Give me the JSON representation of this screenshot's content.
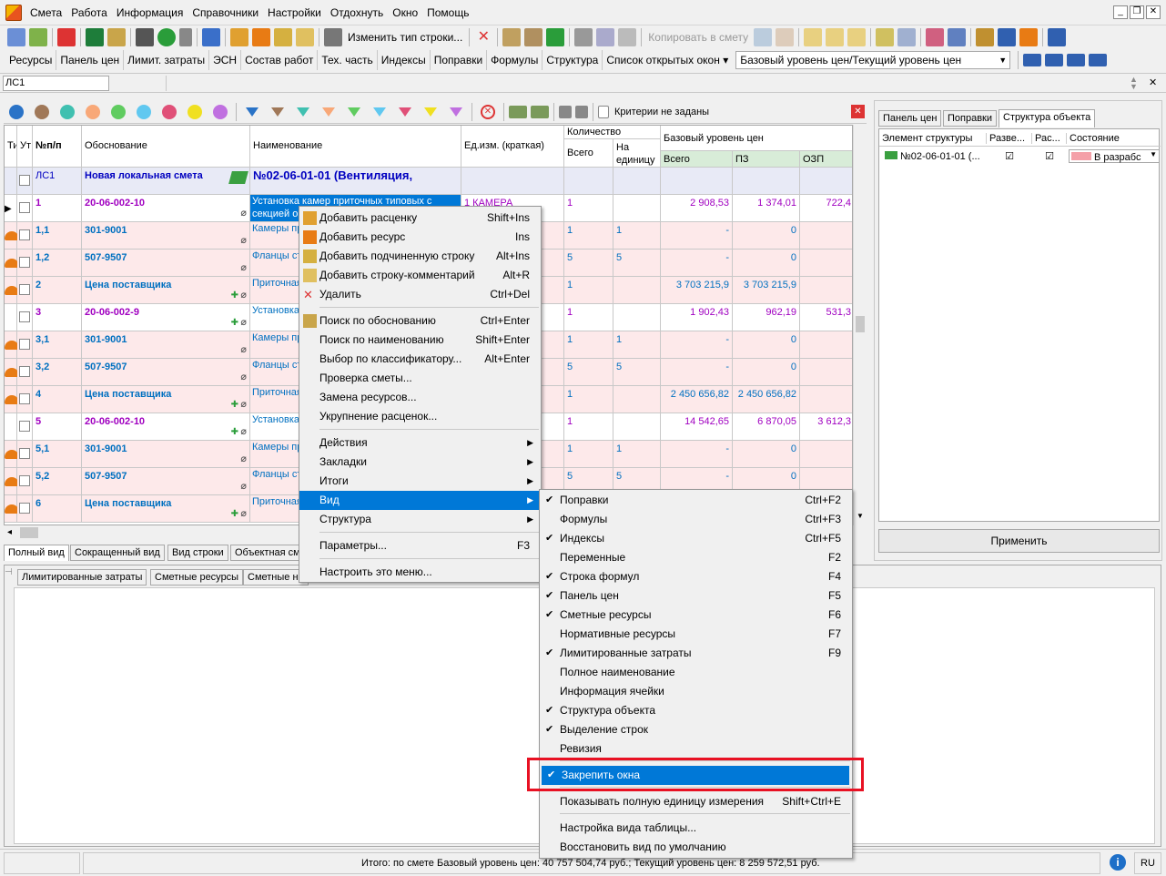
{
  "menubar": {
    "items": [
      "Смета",
      "Работа",
      "Информация",
      "Справочники",
      "Настройки",
      "Отдохнуть",
      "Окно",
      "Помощь"
    ]
  },
  "toolbar1": {
    "change_type": "Изменить тип строки...",
    "copy_to": "Копировать в смету"
  },
  "toolbar2": {
    "tabs": [
      "Ресурсы",
      "Панель цен",
      "Лимит. затраты",
      "ЭСН",
      "Состав работ",
      "Тех. часть",
      "Индексы",
      "Поправки",
      "Формулы",
      "Структура"
    ],
    "open_windows": "Список открытых окон",
    "price_level": "Базовый уровень цен/Текущий уровень цен"
  },
  "doc": {
    "tab": "ЛС1"
  },
  "filterbar": {
    "criteria": "Критерии не заданы"
  },
  "grid": {
    "headers": {
      "ti": "Ти",
      "ut": "Ут",
      "num": "№п/п",
      "basis": "Обоснование",
      "name": "Наименование",
      "unit": "Ед.изм. (краткая)",
      "qty": "Количество",
      "qty_total": "Всего",
      "qty_unit": "На единицу",
      "base": "Базовый уровень цен",
      "base_total": "Всего",
      "pz": "ПЗ",
      "ozp": "ОЗП"
    },
    "top": {
      "num": "ЛС1",
      "basis": "Новая локальная смета",
      "name": "№02-06-01-01 (Вентиляция,"
    },
    "rows": [
      {
        "num": "1",
        "basis": "20-06-002-10",
        "name": "Установка камер приточных типовых с секцией ор",
        "unit": "1 КАМЕРА",
        "qt": "1",
        "qu": "",
        "tot": "2 908,53",
        "pz": "1 374,01",
        "ozp": "722,4",
        "kind": "work"
      },
      {
        "num": "1,1",
        "basis": "301-9001",
        "name": "Камеры пр",
        "unit": "",
        "qt": "1",
        "qu": "1",
        "tot": "-",
        "pz": "0",
        "ozp": "",
        "kind": "res"
      },
      {
        "num": "1,2",
        "basis": "507-9507",
        "name": "Фланцы ст",
        "unit": "",
        "qt": "5",
        "qu": "5",
        "tot": "-",
        "pz": "0",
        "ozp": "",
        "kind": "res"
      },
      {
        "num": "2",
        "basis": "Цена поставщика",
        "name": "Приточная Р=800Па)",
        "unit": "",
        "qt": "1",
        "qu": "",
        "tot": "3 703 215,9",
        "pz": "3 703 215,9",
        "ozp": "",
        "kind": "price"
      },
      {
        "num": "3",
        "basis": "20-06-002-9",
        "name": "Установка секцией ор",
        "unit": "",
        "qt": "1",
        "qu": "",
        "tot": "1 902,43",
        "pz": "962,19",
        "ozp": "531,3",
        "kind": "work"
      },
      {
        "num": "3,1",
        "basis": "301-9001",
        "name": "Камеры пр",
        "unit": "",
        "qt": "1",
        "qu": "1",
        "tot": "-",
        "pz": "0",
        "ozp": "",
        "kind": "res"
      },
      {
        "num": "3,2",
        "basis": "507-9507",
        "name": "Фланцы ст",
        "unit": "",
        "qt": "5",
        "qu": "5",
        "tot": "-",
        "pz": "0",
        "ozp": "",
        "kind": "res"
      },
      {
        "num": "4",
        "basis": "Цена поставщика",
        "name": "Приточная Р=600Па)",
        "unit": "",
        "qt": "1",
        "qu": "",
        "tot": "2 450 656,82",
        "pz": "2 450 656,82",
        "ozp": "",
        "kind": "price"
      },
      {
        "num": "5",
        "basis": "20-06-002-10",
        "name": "Установка секцией ор",
        "unit": "",
        "qt": "1",
        "qu": "",
        "tot": "14 542,65",
        "pz": "6 870,05",
        "ozp": "3 612,3",
        "kind": "work2"
      },
      {
        "num": "5,1",
        "basis": "301-9001",
        "name": "Камеры пр",
        "unit": "",
        "qt": "1",
        "qu": "1",
        "tot": "-",
        "pz": "0",
        "ozp": "",
        "kind": "res"
      },
      {
        "num": "5,2",
        "basis": "507-9507",
        "name": "Фланцы ст",
        "unit": "",
        "qt": "5",
        "qu": "5",
        "tot": "-",
        "pz": "0",
        "ozp": "",
        "kind": "res"
      },
      {
        "num": "6",
        "basis": "Цена поставщика",
        "name": "Приточная Р=800Па)",
        "unit": "",
        "qt": "",
        "qu": "",
        "tot": "",
        "pz": "",
        "ozp": "",
        "kind": "price"
      }
    ]
  },
  "bottom_tabs": [
    "Полный вид",
    "Сокращенный вид",
    "Вид строки",
    "Объектная см"
  ],
  "lower_tabs": [
    "Лимитированные затраты",
    "Сметные ресурсы",
    "Сметные ни"
  ],
  "right_panel": {
    "tabs": [
      "Панель цен",
      "Поправки",
      "Структура объекта"
    ],
    "cols": [
      "Элемент структуры",
      "Разве...",
      "Рас...",
      "Состояние"
    ],
    "item": "№02-06-01-01 (...",
    "state": "В разрабс",
    "apply": "Применить"
  },
  "context_menu": {
    "items": [
      {
        "label": "Добавить расценку",
        "shortcut": "Shift+Ins"
      },
      {
        "label": "Добавить ресурс",
        "shortcut": "Ins"
      },
      {
        "label": "Добавить подчиненную строку",
        "shortcut": "Alt+Ins"
      },
      {
        "label": "Добавить строку-комментарий",
        "shortcut": "Alt+R"
      },
      {
        "label": "Удалить",
        "shortcut": "Ctrl+Del"
      },
      {
        "label": "Поиск по обоснованию",
        "shortcut": "Ctrl+Enter"
      },
      {
        "label": "Поиск по наименованию",
        "shortcut": "Shift+Enter"
      },
      {
        "label": "Выбор по классификатору...",
        "shortcut": "Alt+Enter"
      },
      {
        "label": "Проверка сметы...",
        "shortcut": ""
      },
      {
        "label": "Замена ресурсов...",
        "shortcut": ""
      },
      {
        "label": "Укрупнение расценок...",
        "shortcut": ""
      },
      {
        "label": "Действия",
        "shortcut": ""
      },
      {
        "label": "Закладки",
        "shortcut": ""
      },
      {
        "label": "Итоги",
        "shortcut": ""
      },
      {
        "label": "Вид",
        "shortcut": ""
      },
      {
        "label": "Структура",
        "shortcut": ""
      },
      {
        "label": "Параметры...",
        "shortcut": "F3"
      },
      {
        "label": "Настроить это меню...",
        "shortcut": ""
      }
    ]
  },
  "view_submenu": {
    "items": [
      {
        "label": "Поправки",
        "shortcut": "Ctrl+F2",
        "checked": true
      },
      {
        "label": "Формулы",
        "shortcut": "Ctrl+F3",
        "checked": false
      },
      {
        "label": "Индексы",
        "shortcut": "Ctrl+F5",
        "checked": true
      },
      {
        "label": "Переменные",
        "shortcut": "F2",
        "checked": false
      },
      {
        "label": "Строка формул",
        "shortcut": "F4",
        "checked": true
      },
      {
        "label": "Панель цен",
        "shortcut": "F5",
        "checked": true
      },
      {
        "label": "Сметные ресурсы",
        "shortcut": "F6",
        "checked": true
      },
      {
        "label": "Нормативные ресурсы",
        "shortcut": "F7",
        "checked": false
      },
      {
        "label": "Лимитированные затраты",
        "shortcut": "F9",
        "checked": true
      },
      {
        "label": "Полное наименование",
        "shortcut": "",
        "checked": false
      },
      {
        "label": "Информация ячейки",
        "shortcut": "",
        "checked": false
      },
      {
        "label": "Структура объекта",
        "shortcut": "",
        "checked": true
      },
      {
        "label": "Выделение строк",
        "shortcut": "",
        "checked": true
      },
      {
        "label": "Ревизия",
        "shortcut": "",
        "checked": false
      },
      {
        "label": "Закрепить окна",
        "shortcut": "",
        "checked": true
      },
      {
        "label": "Показывать полную единицу измерения",
        "shortcut": "Shift+Ctrl+E",
        "checked": false
      },
      {
        "label": "Настройка вида таблицы...",
        "shortcut": "",
        "checked": false
      },
      {
        "label": "Восстановить вид по умолчанию",
        "shortcut": "",
        "checked": false
      }
    ]
  },
  "statusbar": {
    "text": "Итого: по смете Базовый уровень цен: 40 757 504,74 руб.; Текущий уровень цен: 8 259 572,51 руб.",
    "lang": "RU"
  },
  "colors": {
    "accent": "#0078d7",
    "highlight_box": "#e81123",
    "pink_row": "#fde9ea"
  }
}
